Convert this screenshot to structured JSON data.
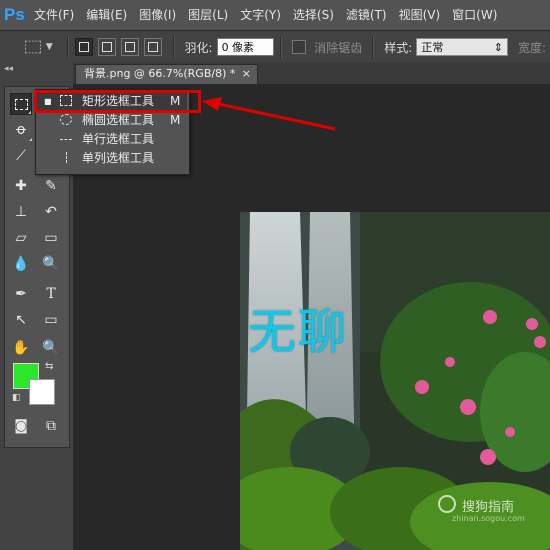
{
  "app": {
    "logo": "Ps"
  },
  "menu": [
    "文件(F)",
    "编辑(E)",
    "图像(I)",
    "图层(L)",
    "文字(Y)",
    "选择(S)",
    "滤镜(T)",
    "视图(V)",
    "窗口(W)"
  ],
  "options": {
    "feather_label": "羽化:",
    "feather_value": "0 像素",
    "antialias_label": "消除锯齿",
    "style_label": "样式:",
    "style_value": "正常",
    "width_label": "宽度:"
  },
  "document_tab": {
    "title": "背景.png @ 66.7%(RGB/8) *",
    "close": "×"
  },
  "flyout": {
    "items": [
      {
        "label": "矩形选框工具",
        "shortcut": "M",
        "icon": "rect-marquee-icon",
        "selected": true
      },
      {
        "label": "椭圆选框工具",
        "shortcut": "M",
        "icon": "ellipse-marquee-icon",
        "selected": false
      },
      {
        "label": "单行选框工具",
        "shortcut": "",
        "icon": "single-row-marquee-icon",
        "selected": false
      },
      {
        "label": "单列选框工具",
        "shortcut": "",
        "icon": "single-column-marquee-icon",
        "selected": false
      }
    ]
  },
  "colors": {
    "foreground": "#2ce62c",
    "background": "#ffffff",
    "annotation": "#e00000"
  },
  "image": {
    "overlay_text": "无聊"
  },
  "watermark": {
    "text_cn": "搜狗指南",
    "text_en": "zhinan.sogou.com"
  }
}
